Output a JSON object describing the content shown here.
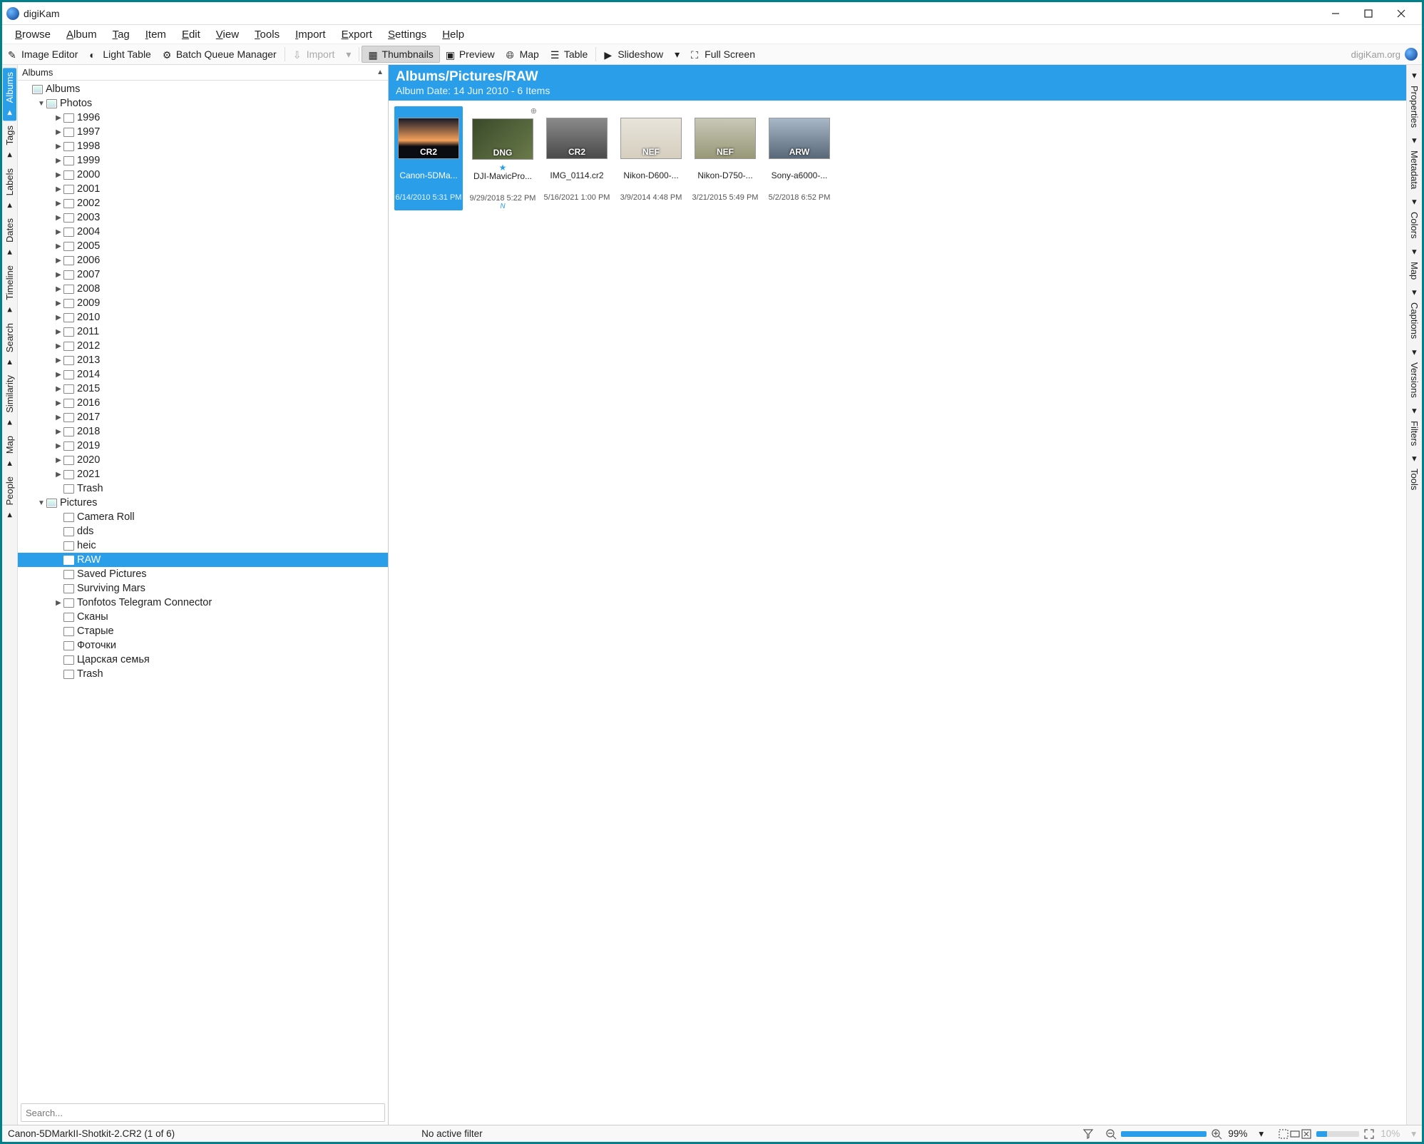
{
  "app_title": "digiKam",
  "window_controls": {
    "min": "minimize-icon",
    "max": "maximize-icon",
    "close": "close-icon"
  },
  "menubar": [
    "Browse",
    "Album",
    "Tag",
    "Item",
    "Edit",
    "View",
    "Tools",
    "Import",
    "Export",
    "Settings",
    "Help"
  ],
  "toolbar": {
    "image_editor": "Image Editor",
    "light_table": "Light Table",
    "batch": "Batch Queue Manager",
    "import": "Import",
    "thumbnails": "Thumbnails",
    "preview": "Preview",
    "map": "Map",
    "table": "Table",
    "slideshow": "Slideshow",
    "fullscreen": "Full Screen",
    "brand": "digiKam.org"
  },
  "left_tabs": [
    "Albums",
    "Tags",
    "Labels",
    "Dates",
    "Timeline",
    "Search",
    "Similarity",
    "Map",
    "People"
  ],
  "right_tabs": [
    "Properties",
    "Metadata",
    "Colors",
    "Map",
    "Captions",
    "Versions",
    "Filters",
    "Tools"
  ],
  "left_panel_header": "Albums",
  "tree": {
    "root": "Albums",
    "photos": {
      "label": "Photos",
      "years": [
        "1996",
        "1997",
        "1998",
        "1999",
        "2000",
        "2001",
        "2002",
        "2003",
        "2004",
        "2005",
        "2006",
        "2007",
        "2008",
        "2009",
        "2010",
        "2011",
        "2012",
        "2013",
        "2014",
        "2015",
        "2016",
        "2017",
        "2018",
        "2019",
        "2020",
        "2021"
      ],
      "trash": "Trash"
    },
    "pictures": {
      "label": "Pictures",
      "subs": [
        "Camera Roll",
        "dds",
        "heic",
        "RAW",
        "Saved Pictures",
        "Surviving Mars",
        "Tonfotos Telegram Connector",
        "Сканы",
        "Старые",
        "Фоточки",
        "Царская семья",
        "Trash"
      ],
      "selected": "RAW",
      "expandable": [
        "Tonfotos Telegram Connector"
      ]
    }
  },
  "search_placeholder": "Search...",
  "breadcrumb": {
    "path": "Albums/Pictures/RAW",
    "sub": "Album Date: 14 Jun 2010 - 6 Items"
  },
  "thumbs": [
    {
      "name": "Canon-5DMa...",
      "badge": "CR2",
      "date": "6/14/2010 5:31 PM",
      "selected": true,
      "bg": "linear-gradient(#1a1a2a 0%,#f5a05a 55%,#0b0b12 70%)"
    },
    {
      "name": "DJI-MavicPro...",
      "badge": "DNG",
      "date": "9/29/2018 5:22 PM",
      "star": true,
      "bg": "linear-gradient(135deg,#3a4a2a,#6a7a4a)",
      "geo": true,
      "note": "N"
    },
    {
      "name": "IMG_0114.cr2",
      "badge": "CR2",
      "date": "5/16/2021 1:00 PM",
      "bg": "linear-gradient(#8a8a8a,#4a4a4a)"
    },
    {
      "name": "Nikon-D600-...",
      "badge": "NEF",
      "date": "3/9/2014 4:48 PM",
      "bg": "linear-gradient(#e8e4da,#d6cfc0)"
    },
    {
      "name": "Nikon-D750-...",
      "badge": "NEF",
      "date": "3/21/2015 5:49 PM",
      "bg": "linear-gradient(#c8c8b8,#989878)"
    },
    {
      "name": "Sony-a6000-...",
      "badge": "ARW",
      "date": "5/2/2018 6:52 PM",
      "bg": "linear-gradient(#a8b8c8,#586878)"
    }
  ],
  "status": {
    "left": "Canon-5DMarkII-Shotkit-2.CR2 (1 of 6)",
    "filter": "No active filter",
    "zoom": "99%",
    "zoom2": "10%"
  }
}
